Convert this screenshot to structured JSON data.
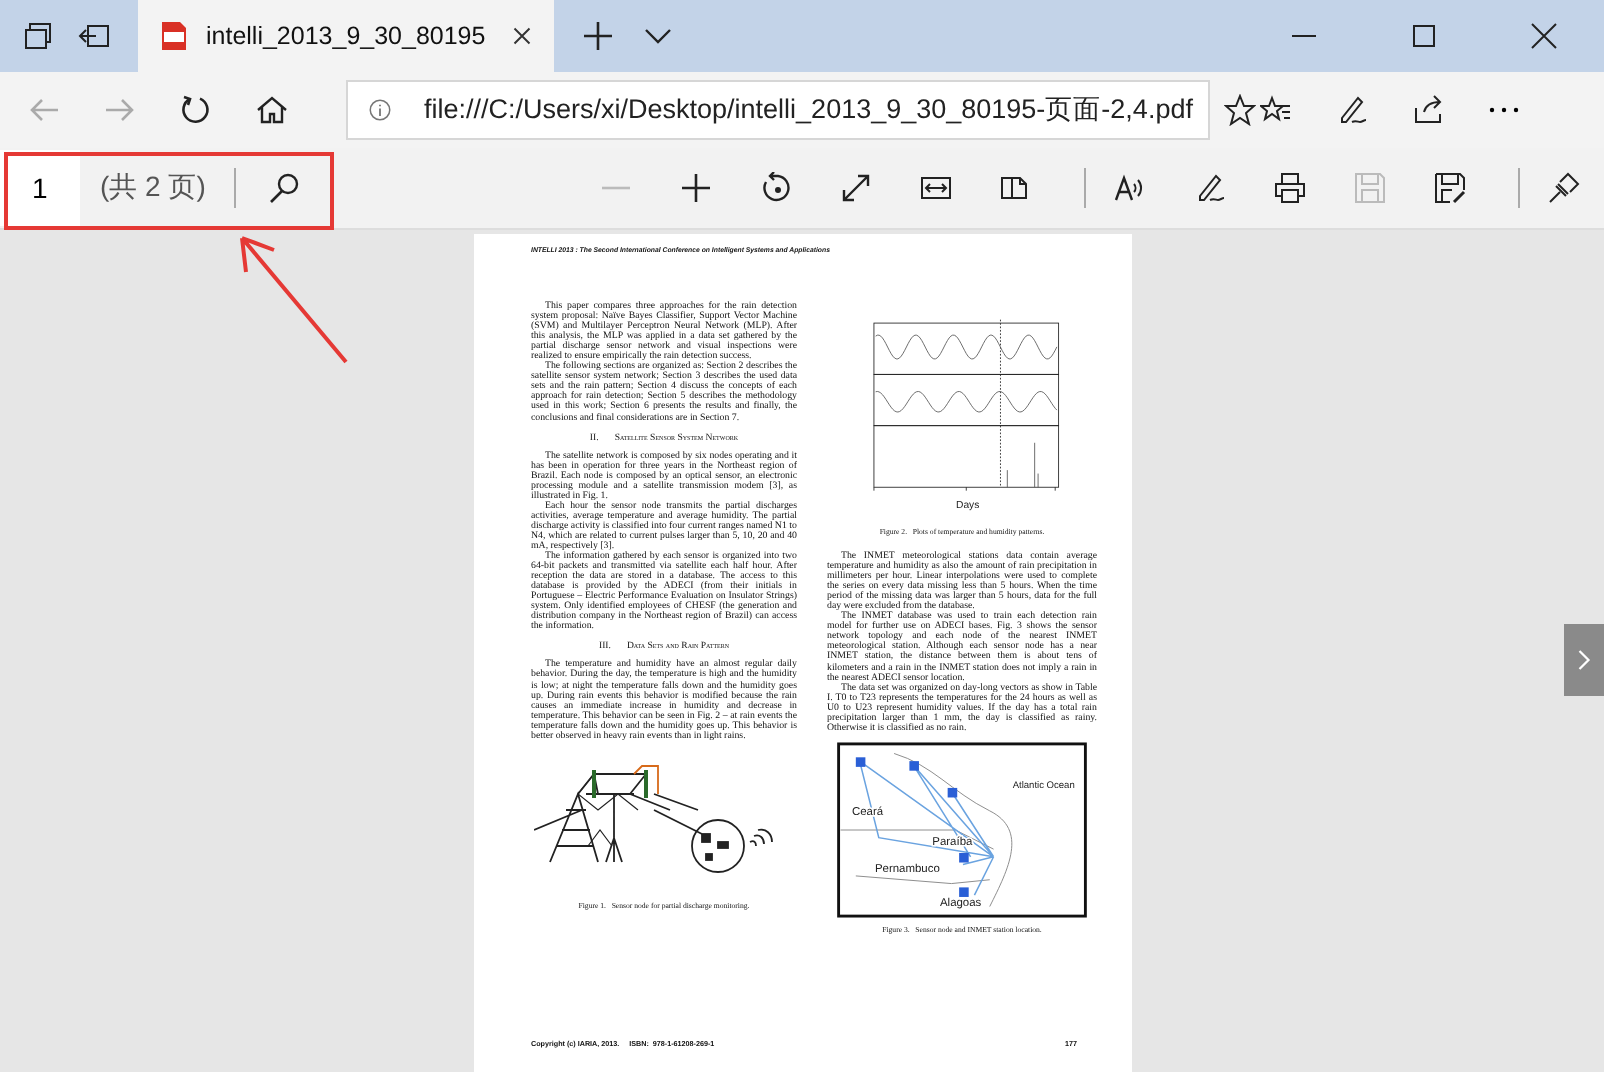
{
  "browser": {
    "tabs": [
      {
        "title": "intelli_2013_9_30_80195",
        "selected": true
      }
    ],
    "address": "file:///C:/Users/xi/Desktop/intelli_2013_9_30_80195-页面-2,4.pdf"
  },
  "pdf_toolbar": {
    "page_number": "1",
    "page_count": "(共 2 页)"
  },
  "annotation": {
    "kind": "box-with-arrow"
  },
  "document": {
    "header": "INTELLI 2013 : The Second International Conference on Intelligent Systems and Applications",
    "left_column": [
      {
        "kind": "paragraph",
        "text": "This paper compares three approaches for the rain detection system proposal: Naïve Bayes Classifier, Support Vector Machine (SVM) and Multilayer Perceptron Neural Network (MLP). After this analysis, the MLP was applied in a data set gathered by the partial discharge sensor network and visual inspections were realized to ensure empirically the rain detection success."
      },
      {
        "kind": "paragraph",
        "text": "The following sections are organized as: Section 2 describes the satellite sensor system network; Section 3 describes the used data sets and the rain pattern; Section 4 discuss the concepts of each approach for rain detection; Section 5 describes the methodology used in this work; Section 6 presents the results and finally, the conclusions and final considerations are in Section 7."
      },
      {
        "kind": "heading",
        "number": "II.",
        "text": "Satellite Sensor System Network"
      },
      {
        "kind": "paragraph",
        "text": "The satellite network is composed by six nodes operating and it has been in operation for three years in the Northeast region of Brazil. Each node is composed by an optical sensor, an electronic processing module and a satellite transmission modem [3], as illustrated in Fig. 1."
      },
      {
        "kind": "paragraph",
        "text": "Each hour the sensor node transmits the partial discharges activities, average temperature and average humidity. The partial discharge activity is classified into four current ranges named N1 to N4, which are related to current pulses larger than 5, 10, 20 and 40 mA, respectively [3]."
      },
      {
        "kind": "paragraph",
        "text": "The information gathered by each sensor is organized into two 64-bit packets and transmitted via satellite each half hour. After reception the data are stored in a database. The access to this database is provided by the ADECI (from their initials in Portuguese – Electric Performance Evaluation on Insulator Strings) system. Only identified employees of CHESF (the generation and distribution company in the Northeast region of Brazil) can access the information."
      },
      {
        "kind": "heading",
        "number": "III.",
        "text": "Data Sets and Rain Pattern"
      },
      {
        "kind": "paragraph",
        "text": "The temperature and humidity have an almost regular daily behavior. During the day, the temperature is high and the humidity is low; at night the temperature falls down and the humidity goes up. During rain events this behavior is modified because the rain causes an immediate increase in humidity and decrease in temperature. This behavior can be seen in Fig. 2 – at rain events the temperature falls down and the humidity goes up. This behavior is better observed in heavy rain events than in light rains."
      },
      {
        "kind": "figure-sensor",
        "caption": "Figure 1.   Sensor node for partial discharge monitoring."
      }
    ],
    "right_column": [
      {
        "kind": "figure-plot",
        "labels": [
          "Days"
        ],
        "caption": "Figure 2.   Plots of temperature and humidity patterns."
      },
      {
        "kind": "paragraph",
        "text": "The INMET meteorological stations data contain average temperature and humidity as also the amount of rain precipitation in millimeters per hour. Linear interpolations were used to complete the series on every data missing less than 5 hours. When the time period of the missing data was larger than 5 hours, data for the full day were excluded from the database."
      },
      {
        "kind": "paragraph",
        "text": "The INMET database was used to train each detection rain model for further use on ADECI bases. Fig. 3 shows the sensor network topology and each node of the nearest INMET meteorological station. Although each sensor node has a near INMET station, the distance between them is about tens of kilometers and a rain in the INMET station does not imply a rain in the nearest ADECI sensor location."
      },
      {
        "kind": "paragraph",
        "text": "The data set was organized on day-long vectors as show in Table I. T0 to T23 represents the temperatures for the 24 hours as well as U0 to U23 represent humidity values. If the day has a total rain precipitation larger than 1 mm, the day is classified as rainy. Otherwise it is classified as no rain."
      },
      {
        "kind": "figure-map",
        "labels": [
          "Ceará",
          "Paraíba",
          "Pernambuco",
          "Alagoas",
          "Atlantic Ocean"
        ],
        "caption": "Figure 3.   Sensor node and INMET station location."
      }
    ],
    "footer": "Copyright (c) IARIA, 2013.     ISBN:  978-1-61208-269-1",
    "page_number": "177"
  }
}
